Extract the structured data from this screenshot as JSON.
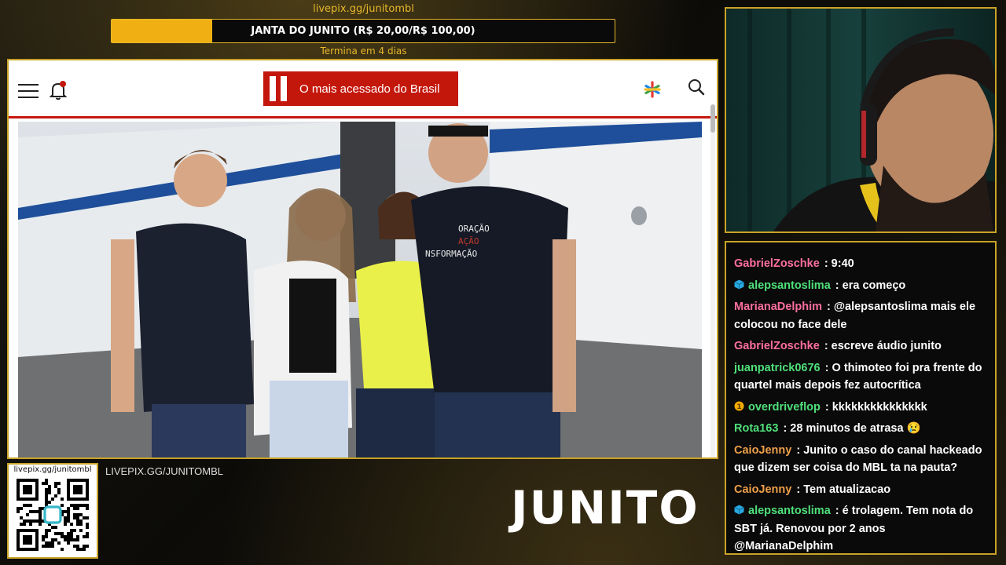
{
  "goal": {
    "url": "livepix.gg/junitombl",
    "title": "JANTA DO JUNITO (R$ 20,00/R$ 100,00)",
    "current": 20,
    "target": 100,
    "progress": 0.2,
    "deadline": "Termina em 4 dias"
  },
  "browser": {
    "brand_text": "O mais acessado do Brasil",
    "brand_color": "#c4170c",
    "icons": [
      "menu-icon",
      "bell-icon",
      "star-icon",
      "search-icon"
    ]
  },
  "chat": {
    "messages": [
      {
        "user": "GabrielZoschke",
        "color": "#ff6f9e",
        "text": ": 9:40",
        "badge": ""
      },
      {
        "user": "alepsantoslima",
        "color": "#4fe07a",
        "text": ": era começo",
        "badge": "cube"
      },
      {
        "user": "MarianaDelphim",
        "color": "#ff6f9e",
        "text": ": @alepsantoslima mais ele colocou no face dele",
        "badge": ""
      },
      {
        "user": "GabrielZoschke",
        "color": "#ff6f9e",
        "text": ": escreve áudio junito",
        "badge": ""
      },
      {
        "user": "juanpatrick0676",
        "color": "#4fe07a",
        "text": ": O thimoteo foi pra frente do quartel mais depois fez autocrítica",
        "badge": ""
      },
      {
        "user": "overdriveflop",
        "color": "#4fe07a",
        "text": ": kkkkkkkkkkkkkkk",
        "badge": "coin"
      },
      {
        "user": "Rota163",
        "color": "#4fe07a",
        "text": ": 28 minutos de atrasa 😢",
        "badge": ""
      },
      {
        "user": "CaioJenny",
        "color": "#f0a04a",
        "text": ": Junito o caso do canal hackeado que dizem ser coisa do MBL ta na pauta?",
        "badge": ""
      },
      {
        "user": "CaioJenny",
        "color": "#f0a04a",
        "text": ": Tem atualizacao",
        "badge": ""
      },
      {
        "user": "alepsantoslima",
        "color": "#4fe07a",
        "text": ": é trolagem. Tem nota do SBT já. Renovou por 2 anos @MarianaDelphim",
        "badge": "cube"
      }
    ]
  },
  "qr": {
    "label": "livepix.gg/junitombl"
  },
  "footer": {
    "livepix": "LIVEPIX.GG/JUNITOMBL",
    "logo": "JUNITO"
  }
}
